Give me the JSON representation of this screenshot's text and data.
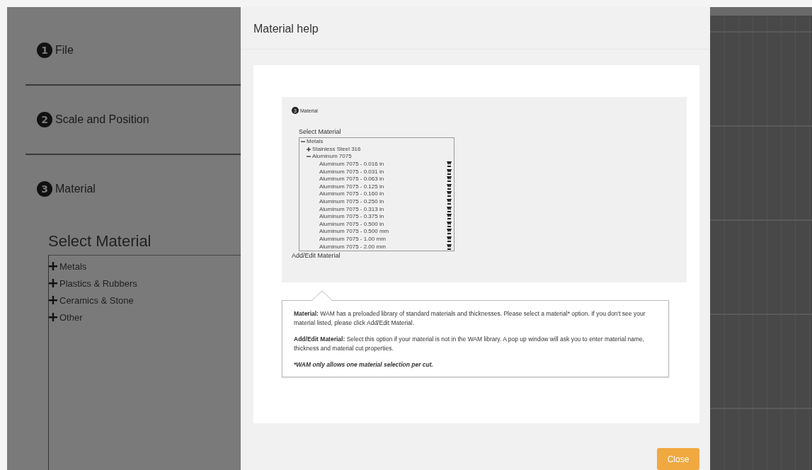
{
  "sidebar": {
    "steps": [
      {
        "number": "1",
        "label": "File"
      },
      {
        "number": "2",
        "label": "Scale and Position"
      },
      {
        "number": "3",
        "label": "Material"
      }
    ],
    "select_title": "Select Material",
    "tree": [
      {
        "label": "Metals",
        "expanded": false
      },
      {
        "label": "Plastics & Rubbers",
        "expanded": false
      },
      {
        "label": "Ceramics & Stone",
        "expanded": false
      },
      {
        "label": "Other",
        "expanded": false
      }
    ]
  },
  "dialog": {
    "title": "Material help",
    "example": {
      "step_number": "3",
      "step_label": "Material",
      "select_title": "Select Material",
      "tree": [
        {
          "label": "Metals",
          "expanded": true,
          "children": [
            {
              "label": "Stainless Steel 316",
              "expanded": false
            },
            {
              "label": "Aluminum 7075",
              "expanded": true,
              "children": [
                {
                  "label": "Aluminum 7075 - 0.016 in"
                },
                {
                  "label": "Aluminum 7075 - 0.031 in"
                },
                {
                  "label": "Aluminum 7075 - 0.063 in"
                },
                {
                  "label": "Aluminum 7075 - 0.125 in"
                },
                {
                  "label": "Aluminum 7075 - 0.160 in"
                },
                {
                  "label": "Aluminum 7075 - 0.250 in"
                },
                {
                  "label": "Aluminum 7075 - 0.313 in"
                },
                {
                  "label": "Aluminum 7075 - 0.375 in"
                },
                {
                  "label": "Aluminum 7075 - 0.500 in"
                },
                {
                  "label": "Aluminum 7075 - 0.500 mm"
                },
                {
                  "label": "Aluminum 7075 - 1.00 mm"
                },
                {
                  "label": "Aluminum 7075 - 2.00 mm"
                }
              ]
            }
          ]
        }
      ],
      "add_edit": "Add/Edit Material"
    },
    "help": [
      {
        "label": "Material:",
        "text": "WAM has a preloaded library of standard materials and thicknesses. Please select a material* option. If you don't see your material listed, please click Add/Edit Material."
      },
      {
        "label": "Add/Edit Material:",
        "text": "Select this option if your material is not in the WAM library. A pop up window will ask you to enter material name, thickness and material cut properties."
      }
    ],
    "note": "*WAM only allows one material selection per cut.",
    "close_button": "Close"
  }
}
